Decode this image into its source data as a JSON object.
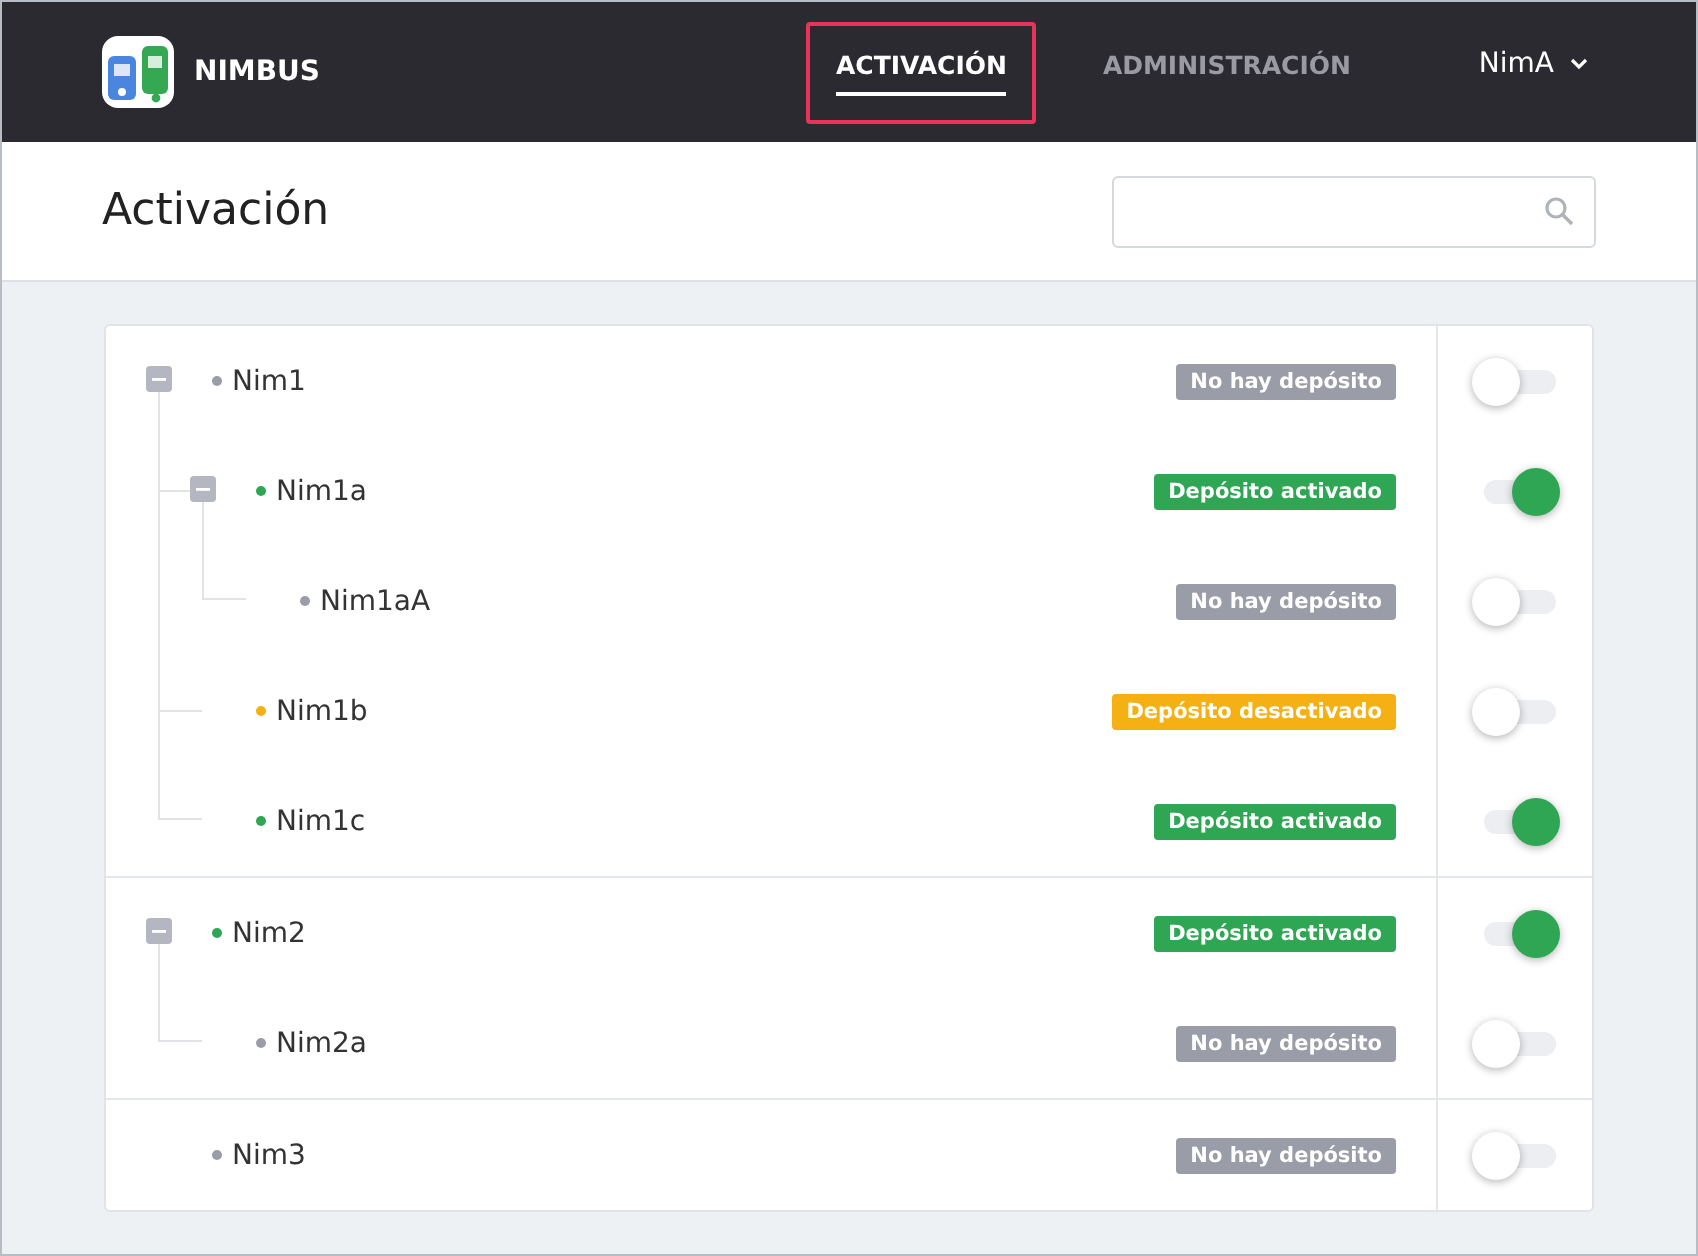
{
  "app": {
    "name": "NIMBUS"
  },
  "nav": [
    {
      "label": "ACTIVACIÓN",
      "selected": true
    },
    {
      "label": "ADMINISTRACIÓN",
      "selected": false
    }
  ],
  "user": {
    "name": "NimA"
  },
  "page": {
    "title": "Activación"
  },
  "tree": [
    {
      "name": "Nim1",
      "color": "#9a9ca8",
      "badge": {
        "text": "No hay depósito",
        "kind": "none"
      },
      "on": false,
      "expanded": true,
      "children": [
        {
          "name": "Nim1a",
          "color": "#2ea653",
          "badge": {
            "text": "Depósito activado",
            "kind": "active"
          },
          "on": true,
          "expanded": true,
          "children": [
            {
              "name": "Nim1aA",
              "color": "#9a9ca8",
              "badge": {
                "text": "No hay depósito",
                "kind": "none"
              },
              "on": false
            }
          ]
        },
        {
          "name": "Nim1b",
          "color": "#f5b014",
          "badge": {
            "text": "Depósito desactivado",
            "kind": "inactive"
          },
          "on": false
        },
        {
          "name": "Nim1c",
          "color": "#2ea653",
          "badge": {
            "text": "Depósito activado",
            "kind": "active"
          },
          "on": true
        }
      ]
    },
    {
      "name": "Nim2",
      "color": "#2ea653",
      "badge": {
        "text": "Depósito activado",
        "kind": "active"
      },
      "on": true,
      "expanded": true,
      "children": [
        {
          "name": "Nim2a",
          "color": "#9a9ca8",
          "badge": {
            "text": "No hay depósito",
            "kind": "none"
          },
          "on": false
        }
      ]
    },
    {
      "name": "Nim3",
      "color": "#9a9ca8",
      "badge": {
        "text": "No hay depósito",
        "kind": "none"
      },
      "on": false
    }
  ]
}
